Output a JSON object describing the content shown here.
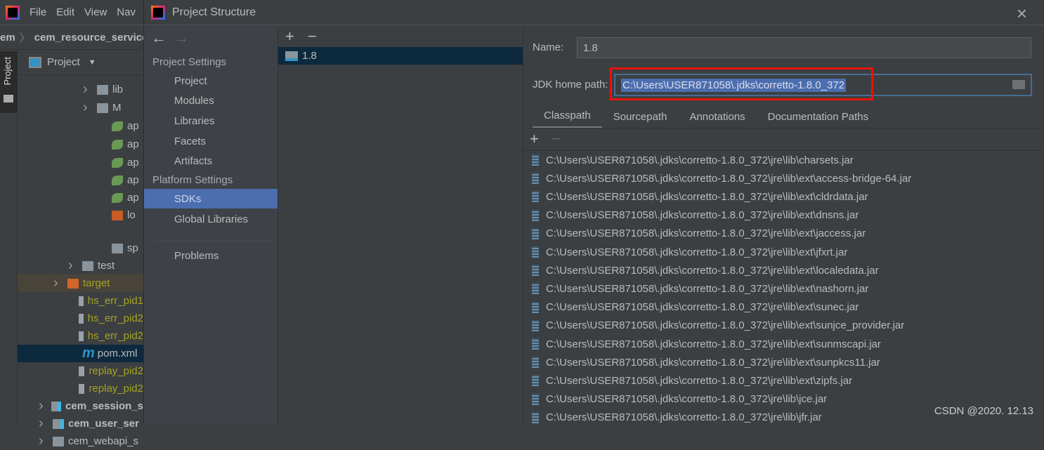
{
  "ide": {
    "menu": [
      "File",
      "Edit",
      "View",
      "Nav"
    ],
    "breadcrumb": [
      "em",
      "cem_resource_service"
    ],
    "tool_tab": "Project",
    "tree_header": "Project",
    "tree": [
      {
        "label": "lib",
        "indent": 3,
        "type": "folder",
        "chev": true
      },
      {
        "label": "M",
        "indent": 3,
        "type": "folder",
        "chev": true
      },
      {
        "label": "ap",
        "indent": 4,
        "type": "spring"
      },
      {
        "label": "ap",
        "indent": 4,
        "type": "spring"
      },
      {
        "label": "ap",
        "indent": 4,
        "type": "spring"
      },
      {
        "label": "ap",
        "indent": 4,
        "type": "spring"
      },
      {
        "label": "ap",
        "indent": 4,
        "type": "spring"
      },
      {
        "label": "lo",
        "indent": 4,
        "type": "xml"
      },
      {
        "label": "sp",
        "indent": 4,
        "type": "chart"
      },
      {
        "label": "test",
        "indent": 2,
        "type": "folder",
        "chev": true
      },
      {
        "label": "target",
        "indent": 1,
        "type": "excluded",
        "chev": true
      },
      {
        "label": "hs_err_pid1",
        "indent": 2,
        "type": "file",
        "ignored": true
      },
      {
        "label": "hs_err_pid2",
        "indent": 2,
        "type": "file",
        "ignored": true
      },
      {
        "label": "hs_err_pid2",
        "indent": 2,
        "type": "file",
        "ignored": true
      },
      {
        "label": "pom.xml",
        "indent": 2,
        "type": "maven",
        "selected": true
      },
      {
        "label": "replay_pid2",
        "indent": 2,
        "type": "file",
        "ignored": true
      },
      {
        "label": "replay_pid2",
        "indent": 2,
        "type": "file",
        "ignored": true
      },
      {
        "label": "cem_session_s",
        "indent": 0,
        "type": "module",
        "chev": true,
        "bold": true
      },
      {
        "label": "cem_user_ser",
        "indent": 0,
        "type": "module",
        "chev": true,
        "bold": true
      },
      {
        "label": "cem_webapi_s",
        "indent": 0,
        "type": "folder",
        "chev": true
      }
    ]
  },
  "dialog": {
    "title": "Project Structure",
    "close": "×",
    "nav": {
      "back": "←",
      "forward": "→",
      "project_settings": "Project Settings",
      "project_items": [
        "Project",
        "Modules",
        "Libraries",
        "Facets",
        "Artifacts"
      ],
      "platform_settings": "Platform Settings",
      "platform_items": [
        "SDKs",
        "Global Libraries"
      ],
      "selected": "SDKs",
      "problems": "Problems"
    },
    "sdk_list": {
      "add": "+",
      "remove": "−",
      "items": [
        "1.8"
      ]
    },
    "detail": {
      "name_label": "Name:",
      "name_value": "1.8",
      "jdk_label": "JDK home path:",
      "jdk_value": "C:\\Users\\USER871058\\.jdks\\corretto-1.8.0_372",
      "tabs": [
        "Classpath",
        "Sourcepath",
        "Annotations",
        "Documentation Paths"
      ],
      "active_tab": "Classpath",
      "add": "+",
      "remove": "−",
      "classpath": [
        "C:\\Users\\USER871058\\.jdks\\corretto-1.8.0_372\\jre\\lib\\charsets.jar",
        "C:\\Users\\USER871058\\.jdks\\corretto-1.8.0_372\\jre\\lib\\ext\\access-bridge-64.jar",
        "C:\\Users\\USER871058\\.jdks\\corretto-1.8.0_372\\jre\\lib\\ext\\cldrdata.jar",
        "C:\\Users\\USER871058\\.jdks\\corretto-1.8.0_372\\jre\\lib\\ext\\dnsns.jar",
        "C:\\Users\\USER871058\\.jdks\\corretto-1.8.0_372\\jre\\lib\\ext\\jaccess.jar",
        "C:\\Users\\USER871058\\.jdks\\corretto-1.8.0_372\\jre\\lib\\ext\\jfxrt.jar",
        "C:\\Users\\USER871058\\.jdks\\corretto-1.8.0_372\\jre\\lib\\ext\\localedata.jar",
        "C:\\Users\\USER871058\\.jdks\\corretto-1.8.0_372\\jre\\lib\\ext\\nashorn.jar",
        "C:\\Users\\USER871058\\.jdks\\corretto-1.8.0_372\\jre\\lib\\ext\\sunec.jar",
        "C:\\Users\\USER871058\\.jdks\\corretto-1.8.0_372\\jre\\lib\\ext\\sunjce_provider.jar",
        "C:\\Users\\USER871058\\.jdks\\corretto-1.8.0_372\\jre\\lib\\ext\\sunmscapi.jar",
        "C:\\Users\\USER871058\\.jdks\\corretto-1.8.0_372\\jre\\lib\\ext\\sunpkcs11.jar",
        "C:\\Users\\USER871058\\.jdks\\corretto-1.8.0_372\\jre\\lib\\ext\\zipfs.jar",
        "C:\\Users\\USER871058\\.jdks\\corretto-1.8.0_372\\jre\\lib\\jce.jar",
        "C:\\Users\\USER871058\\.jdks\\corretto-1.8.0_372\\jre\\lib\\jfr.jar"
      ]
    }
  },
  "watermark": "CSDN @2020. 12.13",
  "colors": {
    "selection": "#4b6eaf",
    "highlight_box": "#e8130c",
    "text_selection": "#2f65ca"
  }
}
